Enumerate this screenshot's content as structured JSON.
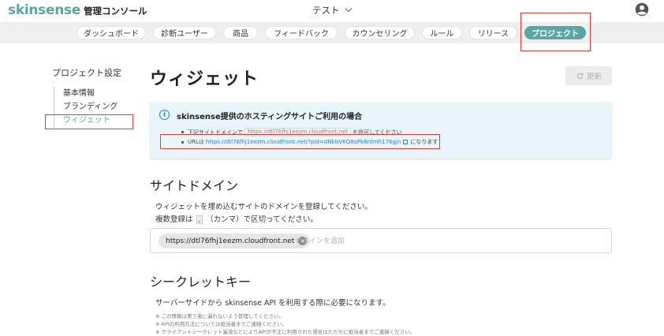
{
  "header": {
    "brand": "skinsense",
    "brand_sub": "管理コンソール",
    "tenant": "テスト"
  },
  "nav": {
    "items": [
      {
        "label": "ダッシュボード",
        "active": false
      },
      {
        "label": "診断ユーザー",
        "active": false
      },
      {
        "label": "商品",
        "active": false
      },
      {
        "label": "フィードバック",
        "active": false
      },
      {
        "label": "カウンセリング",
        "active": false
      },
      {
        "label": "ルール",
        "active": false
      },
      {
        "label": "リリース",
        "active": false
      },
      {
        "label": "プロジェクト",
        "active": true
      }
    ]
  },
  "sidebar": {
    "title": "プロジェクト設定",
    "items": [
      {
        "label": "基本情報",
        "active": false
      },
      {
        "label": "ブランディング",
        "active": false
      },
      {
        "label": "ウィジェット",
        "active": true
      }
    ]
  },
  "main": {
    "title": "ウィジェット",
    "refresh_label": "更新",
    "info": {
      "heading": "skinsense提供のホスティングサイトご利用の場合",
      "line1_prefix": "下記サイトドメインで",
      "line1_code": "https://dtl76fhj1eezm.cloudfront.net",
      "line1_suffix": "を許可してください",
      "line2_prefix": "URLは",
      "line2_link": "https://dtl76fhj1eezm.cloudfront.net/?pid=dNbbVKQ8oPk8rdmh176gjn",
      "line2_suffix": "になります"
    },
    "site_domain": {
      "title": "サイトドメイン",
      "desc1": "ウィジェットを埋め込むサイトのドメインを登録してください。",
      "desc2_prefix": "複数登録は",
      "desc2_chip": ",",
      "desc2_suffix": "（カンマ）で区切ってください。",
      "chip": "https://dtl76fhj1eezm.cloudfront.net",
      "placeholder": "ドメインを追加"
    },
    "secret_key": {
      "title": "シークレットキー",
      "desc": "サーバーサイドから skinsense API を利用する際に必要になります。",
      "notes": [
        "※ この情報は第三者に漏れないよう管理してください。",
        "※ APIの利用方法については担当者までご連絡ください。",
        "※ クライアントシークレット漏洩などによりAPIが不正に利用された場合はただちに担当者までご連絡ください。"
      ]
    }
  },
  "colors": {
    "accent": "#5aa6a2",
    "link": "#1e88c8",
    "highlight_box": "#e53935"
  }
}
